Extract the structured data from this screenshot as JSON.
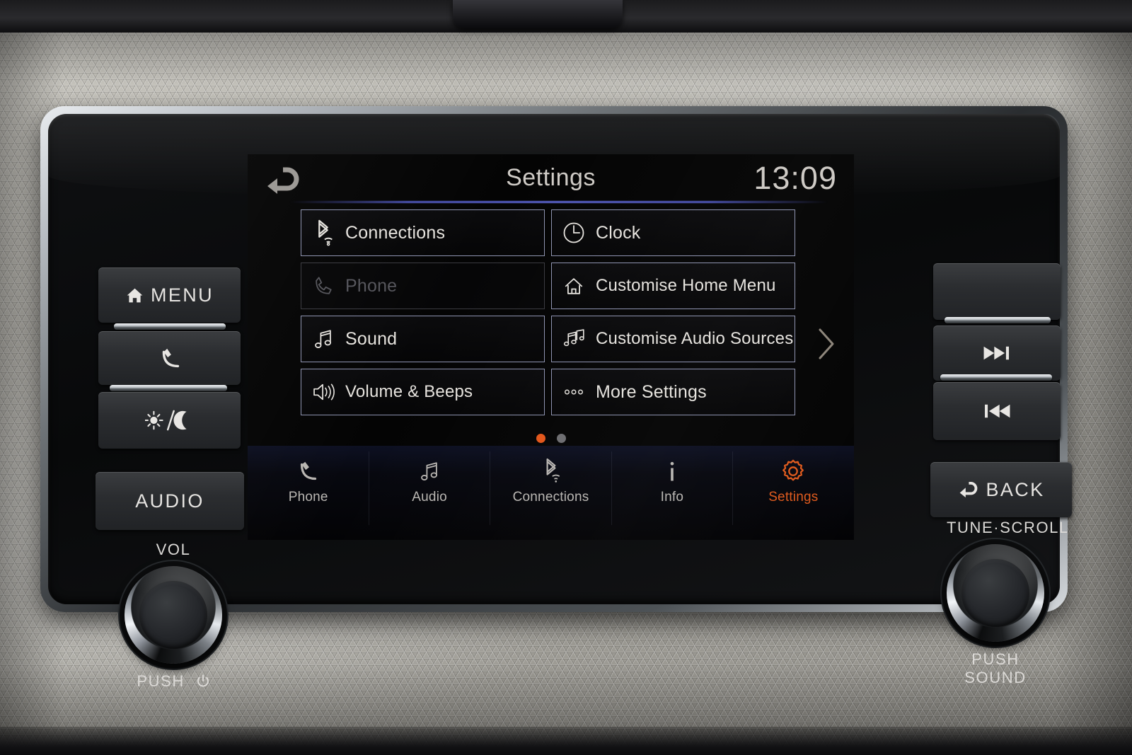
{
  "screen": {
    "header": {
      "back_icon": "back-arrow-icon",
      "title": "Settings",
      "time": "13:09"
    },
    "tiles": [
      {
        "label": "Connections",
        "icon": "bluetooth-wifi-icon",
        "enabled": true
      },
      {
        "label": "Clock",
        "icon": "clock-icon",
        "enabled": true
      },
      {
        "label": "Phone",
        "icon": "phone-handset-icon",
        "enabled": false
      },
      {
        "label": "Customise Home Menu",
        "icon": "home-icon",
        "enabled": true
      },
      {
        "label": "Sound",
        "icon": "music-note-icon",
        "enabled": true
      },
      {
        "label": "Customise Audio Sources",
        "icon": "double-music-note-icon",
        "enabled": true
      },
      {
        "label": "Volume & Beeps",
        "icon": "speaker-waves-icon",
        "enabled": true
      },
      {
        "label": "More Settings",
        "icon": "three-dots-icon",
        "enabled": true
      }
    ],
    "next_page_icon": "chevron-right-icon",
    "pagination": {
      "total": 2,
      "active": 1
    },
    "nav": [
      {
        "label": "Phone",
        "icon": "phone-handset-icon",
        "active": false
      },
      {
        "label": "Audio",
        "icon": "music-note-icon",
        "active": false
      },
      {
        "label": "Connections",
        "icon": "bluetooth-wifi-icon",
        "active": false
      },
      {
        "label": "Info",
        "icon": "info-icon",
        "active": false
      },
      {
        "label": "Settings",
        "icon": "gear-icon",
        "active": true
      }
    ]
  },
  "hardware": {
    "left_buttons": [
      {
        "label": "MENU",
        "icon": "home-icon"
      },
      {
        "label": "",
        "icon": "phone-handset-icon"
      },
      {
        "label": "",
        "icon": "sun-moon-icon"
      },
      {
        "label": "AUDIO",
        "icon": ""
      }
    ],
    "right_buttons": [
      {
        "label": "",
        "icon": ""
      },
      {
        "label": "",
        "icon": "next-track-icon"
      },
      {
        "label": "",
        "icon": "previous-track-icon"
      },
      {
        "label": "BACK",
        "icon": "back-arrow-icon"
      }
    ],
    "volume_knob": {
      "top_label": "VOL",
      "bottom_label": "PUSH",
      "bottom_icon": "power-icon"
    },
    "tune_knob": {
      "top_label": "TUNE·SCROLL",
      "bottom_label": "PUSH  SOUND"
    }
  },
  "colors": {
    "accent_orange": "#df5a1d",
    "tile_border": "#8e93b0",
    "text_primary": "#e6e3de",
    "text_dim": "#55555b",
    "header_rule": "#5a62cc"
  }
}
